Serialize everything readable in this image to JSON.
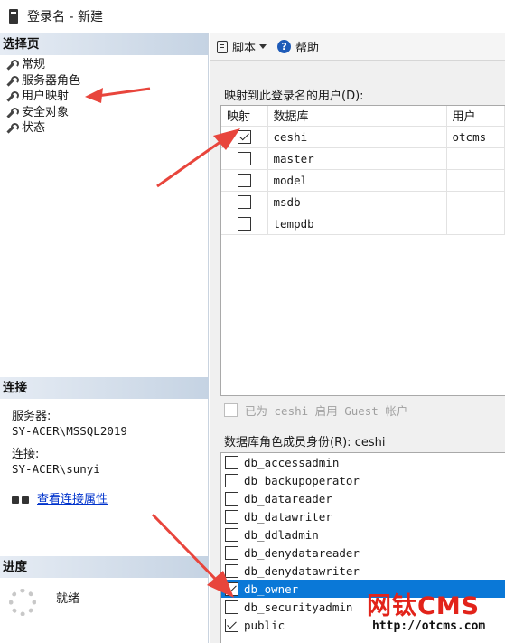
{
  "window": {
    "title": "登录名 - 新建"
  },
  "left": {
    "select_page_header": "选择页",
    "nav_items": [
      {
        "label": "常规"
      },
      {
        "label": "服务器角色"
      },
      {
        "label": "用户映射"
      },
      {
        "label": "安全对象"
      },
      {
        "label": "状态"
      }
    ],
    "connection": {
      "header": "连接",
      "server_label": "服务器:",
      "server_value": "SY-ACER\\MSSQL2019",
      "conn_label": "连接:",
      "conn_value": "SY-ACER\\sunyi",
      "view_props_link": "查看连接属性"
    },
    "progress": {
      "header": "进度",
      "status": "就绪"
    }
  },
  "toolbar": {
    "script_label": "脚本",
    "help_label": "帮助"
  },
  "mapping": {
    "label": "映射到此登录名的用户(D):",
    "columns": [
      "映射",
      "数据库",
      "用户"
    ],
    "rows": [
      {
        "mapped": true,
        "database": "ceshi",
        "user": "otcms"
      },
      {
        "mapped": false,
        "database": "master",
        "user": ""
      },
      {
        "mapped": false,
        "database": "model",
        "user": ""
      },
      {
        "mapped": false,
        "database": "msdb",
        "user": ""
      },
      {
        "mapped": false,
        "database": "tempdb",
        "user": ""
      }
    ]
  },
  "guest": {
    "label": "已为 ceshi 启用 Guest 帐户",
    "checked": false
  },
  "roles": {
    "label": "数据库角色成员身份(R): ceshi",
    "items": [
      {
        "name": "db_accessadmin",
        "checked": false
      },
      {
        "name": "db_backupoperator",
        "checked": false
      },
      {
        "name": "db_datareader",
        "checked": false
      },
      {
        "name": "db_datawriter",
        "checked": false
      },
      {
        "name": "db_ddladmin",
        "checked": false
      },
      {
        "name": "db_denydatareader",
        "checked": false
      },
      {
        "name": "db_denydatawriter",
        "checked": false
      },
      {
        "name": "db_owner",
        "checked": true,
        "selected": true
      },
      {
        "name": "db_securityadmin",
        "checked": false
      },
      {
        "name": "public",
        "checked": true
      }
    ]
  },
  "watermark": {
    "brand": "网钛CMS",
    "url": "http://otcms.com"
  },
  "colors": {
    "selection": "#0a78d7",
    "annotation_arrow": "#e8453c",
    "watermark_red": "#e2231a"
  }
}
